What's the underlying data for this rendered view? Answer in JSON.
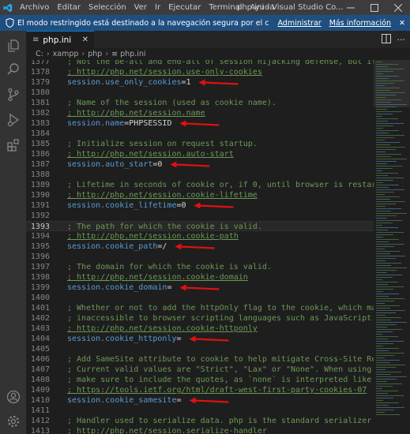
{
  "menu": [
    "Archivo",
    "Editar",
    "Selección",
    "Ver",
    "Ir",
    "Ejecutar",
    "Terminal",
    "Ayuda"
  ],
  "window_title": "php.ini - Visual Studio Co...",
  "window_controls": [
    "minimize-icon",
    "maximize-icon",
    "close-icon"
  ],
  "banner": {
    "message": "El modo restringido está destinado a la navegación segura por el código. Confíe en esta venta...",
    "manage_label": "Administrar",
    "more_info_label": "Más información",
    "close_glyph": "✕"
  },
  "activity_icons": [
    "explorer-icon",
    "search-icon",
    "source-control-icon",
    "run-debug-icon",
    "extensions-icon",
    "account-icon",
    "settings-gear-icon"
  ],
  "tab": {
    "label": "php.ini",
    "icon_glyph": "≡",
    "close_glyph": "✕"
  },
  "breadcrumb": [
    "C:",
    "xampp",
    "php",
    "php.ini"
  ],
  "colors": {
    "accent": "#007acc",
    "banner": "#1f4f80",
    "comment": "#6a9955",
    "key": "#569cd6",
    "arrow": "#e01010"
  },
  "lines": [
    {
      "n": "1377",
      "t": "; Not the be-all and end-all of session hijacking defense, but it's a goo",
      "k": "comment"
    },
    {
      "n": "1378",
      "t": "; http://php.net/session.use-only-cookies",
      "k": "url"
    },
    {
      "n": "1379",
      "key": "session.use_only_cookies",
      "val": "1",
      "k": "setting",
      "arrow": true
    },
    {
      "n": "1380",
      "t": "",
      "k": "blank"
    },
    {
      "n": "1381",
      "t": "; Name of the session (used as cookie name).",
      "k": "comment"
    },
    {
      "n": "1382",
      "t": "; http://php.net/session.name",
      "k": "url"
    },
    {
      "n": "1383",
      "key": "session.name",
      "val": "PHPSESSID",
      "k": "setting",
      "arrow": true
    },
    {
      "n": "1384",
      "t": "",
      "k": "blank"
    },
    {
      "n": "1385",
      "t": "; Initialize session on request startup.",
      "k": "comment"
    },
    {
      "n": "1386",
      "t": "; http://php.net/session.auto-start",
      "k": "url"
    },
    {
      "n": "1387",
      "key": "session.auto_start",
      "val": "0",
      "k": "setting",
      "arrow": true
    },
    {
      "n": "1388",
      "t": "",
      "k": "blank"
    },
    {
      "n": "1389",
      "t": "; Lifetime in seconds of cookie or, if 0, until browser is restarted.",
      "k": "comment"
    },
    {
      "n": "1390",
      "t": "; http://php.net/session.cookie-lifetime",
      "k": "url"
    },
    {
      "n": "1391",
      "key": "session.cookie_lifetime",
      "val": "0",
      "k": "setting",
      "arrow": true
    },
    {
      "n": "1392",
      "t": "",
      "k": "blank"
    },
    {
      "n": "1393",
      "t": "; The path for which the cookie is valid.",
      "k": "comment",
      "current": true
    },
    {
      "n": "1394",
      "t": "; http://php.net/session.cookie-path",
      "k": "url"
    },
    {
      "n": "1395",
      "key": "session.cookie_path",
      "val": "/",
      "k": "setting",
      "arrow": true
    },
    {
      "n": "1396",
      "t": "",
      "k": "blank"
    },
    {
      "n": "1397",
      "t": "; The domain for which the cookie is valid.",
      "k": "comment"
    },
    {
      "n": "1398",
      "t": "; http://php.net/session.cookie-domain",
      "k": "url"
    },
    {
      "n": "1399",
      "key": "session.cookie_domain",
      "val": "",
      "k": "setting",
      "arrow": true
    },
    {
      "n": "1400",
      "t": "",
      "k": "blank"
    },
    {
      "n": "1401",
      "t": "; Whether or not to add the httpOnly flag to the cookie, which makes it",
      "k": "comment"
    },
    {
      "n": "1402",
      "t": "; inaccessible to browser scripting languages such as JavaScript.",
      "k": "comment"
    },
    {
      "n": "1403",
      "t": "; http://php.net/session.cookie-httponly",
      "k": "url"
    },
    {
      "n": "1404",
      "key": "session.cookie_httponly",
      "val": "",
      "k": "setting",
      "arrow": true
    },
    {
      "n": "1405",
      "t": "",
      "k": "blank"
    },
    {
      "n": "1406",
      "t": "; Add SameSite attribute to cookie to help mitigate Cross-Site Request Fo",
      "k": "comment"
    },
    {
      "n": "1407",
      "t": "; Current valid values are \"Strict\", \"Lax\" or \"None\". When using \"None\",",
      "k": "comment"
    },
    {
      "n": "1408",
      "t": "; make sure to include the quotes, as `none` is interpreted like `false`",
      "k": "comment"
    },
    {
      "n": "1409",
      "t": "; https://tools.ietf.org/html/draft-west-first-party-cookies-07",
      "k": "url"
    },
    {
      "n": "1410",
      "key": "session.cookie_samesite",
      "val": "",
      "k": "setting",
      "arrow": true
    },
    {
      "n": "1411",
      "t": "",
      "k": "blank"
    },
    {
      "n": "1412",
      "t": "; Handler used to serialize data. php is the standard serializer of PHP.",
      "k": "comment"
    },
    {
      "n": "1413",
      "t": "; http://php.net/session.serialize-handler",
      "k": "url"
    }
  ]
}
